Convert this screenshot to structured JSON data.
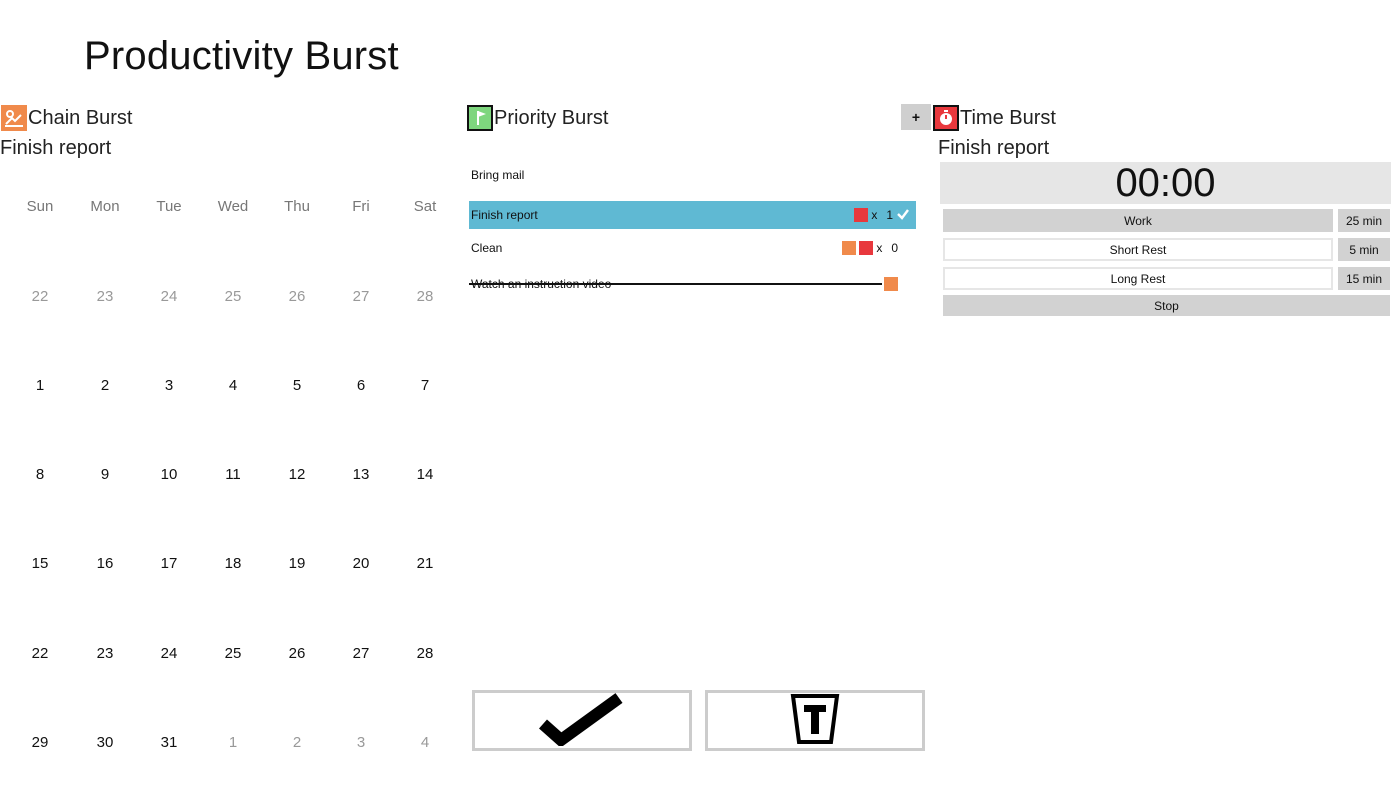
{
  "app_title": "Productivity Burst",
  "chain": {
    "title": "Chain Burst",
    "subtitle": "Finish report",
    "weekdays": [
      "Sun",
      "Mon",
      "Tue",
      "Wed",
      "Thu",
      "Fri",
      "Sat"
    ],
    "weeks": [
      [
        "22",
        "23",
        "24",
        "25",
        "26",
        "27",
        "28"
      ],
      [
        "1",
        "2",
        "3",
        "4",
        "5",
        "6",
        "7"
      ],
      [
        "8",
        "9",
        "10",
        "11",
        "12",
        "13",
        "14"
      ],
      [
        "15",
        "16",
        "17",
        "18",
        "19",
        "20",
        "21"
      ],
      [
        "22",
        "23",
        "24",
        "25",
        "26",
        "27",
        "28"
      ],
      [
        "29",
        "30",
        "31",
        "1",
        "2",
        "3",
        "4"
      ]
    ]
  },
  "priority": {
    "title": "Priority Burst",
    "tasks": [
      {
        "label": "Bring mail"
      },
      {
        "label": "Finish report",
        "count": "1"
      },
      {
        "label": "Clean",
        "count": "0"
      },
      {
        "label": "Watch an instruction video"
      }
    ],
    "count_prefix": "x"
  },
  "time": {
    "title": "Time Burst",
    "plus_label": "+",
    "subtitle": "Finish report",
    "timer": "00:00",
    "modes": [
      {
        "label": "Work",
        "duration": "25 min"
      },
      {
        "label": "Short Rest",
        "duration": "5 min"
      },
      {
        "label": "Long Rest",
        "duration": "15 min"
      }
    ],
    "stop_label": "Stop"
  },
  "colors": {
    "selected_row": "#5fb9d3",
    "chain": "#f08a4b",
    "priority": "#7ed67e",
    "time": "#e8383d"
  }
}
